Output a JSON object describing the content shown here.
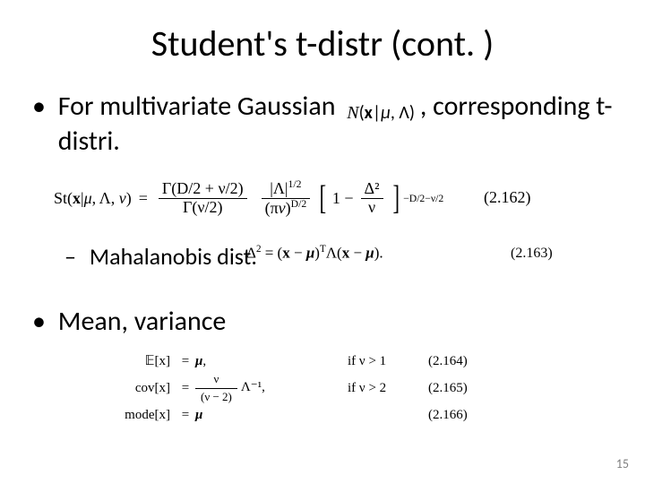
{
  "title": "Student's t-distr (cont. )",
  "bullets": {
    "b1_a": "For multivariate Gaussian",
    "b1_gauss": "𝒩(x|μ, Λ)",
    "b1_c": ", corresponding t-distri.",
    "b2": "Mahalanobis dist.",
    "b3": "Mean, variance"
  },
  "eq162": {
    "lhs": "St(x|μ, Λ, ν)",
    "eq": "=",
    "frac1_num": "Γ(D/2 + ν/2)",
    "frac1_den": "Γ(ν/2)",
    "frac2_num": "|Λ|¹ᐟ²",
    "frac2_den": "(πν)",
    "frac2_den_exp": "D/2",
    "brk_inner_lead": "1 −",
    "brk_inner_num": "Δ²",
    "brk_inner_den": "ν",
    "outer_exp": "−D/2−ν/2",
    "num": "(2.162)"
  },
  "eq163": {
    "body": "Δ² = (x − μ)ᵀ Λ (x − μ).",
    "num": "(2.163)"
  },
  "mv": {
    "r1_l": "𝔼[x]",
    "r1_r": "μ,",
    "r1_c": "if   ν > 1",
    "r1_n": "(2.164)",
    "r2_l": "cov[x]",
    "r2_num": "ν",
    "r2_den": "(ν − 2)",
    "r2_tail": "Λ⁻¹,",
    "r2_c": "if   ν > 2",
    "r2_n": "(2.165)",
    "r3_l": "mode[x]",
    "r3_r": "μ",
    "r3_n": "(2.166)"
  },
  "page": "15"
}
